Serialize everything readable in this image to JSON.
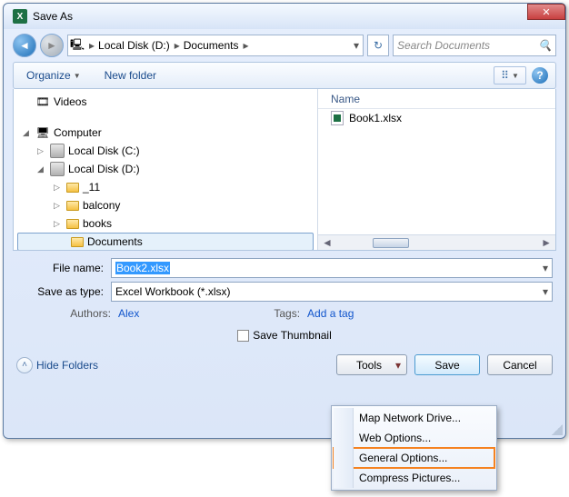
{
  "window": {
    "title": "Save As",
    "close": "✕"
  },
  "nav": {
    "back": "◄",
    "fwd": "►",
    "refresh": "↻"
  },
  "breadcrumb": {
    "root_icon": "🖥",
    "parts": [
      "Local Disk (D:)",
      "Documents"
    ],
    "sep": "▸"
  },
  "search": {
    "placeholder": "Search Documents"
  },
  "toolbar": {
    "organize": "Organize",
    "newfolder": "New folder",
    "view": "⠿",
    "help": "?"
  },
  "tree": {
    "videos": "Videos",
    "computer": "Computer",
    "drive_c": "Local Disk (C:)",
    "drive_d": "Local Disk (D:)",
    "folders": [
      "_11",
      "balcony",
      "books",
      "Documents"
    ]
  },
  "list": {
    "col_name": "Name",
    "files": [
      "Book1.xlsx"
    ]
  },
  "fields": {
    "filename_label": "File name:",
    "filename_value": "Book2.xlsx",
    "type_label": "Save as type:",
    "type_value": "Excel Workbook (*.xlsx)",
    "authors_label": "Authors:",
    "authors_value": "Alex",
    "tags_label": "Tags:",
    "tags_value": "Add a tag",
    "thumb": "Save Thumbnail"
  },
  "footer": {
    "hide": "Hide Folders",
    "tools": "Tools",
    "save": "Save",
    "cancel": "Cancel"
  },
  "menu": {
    "items": [
      "Map Network Drive...",
      "Web Options...",
      "General Options...",
      "Compress Pictures..."
    ],
    "highlight_index": 2
  }
}
